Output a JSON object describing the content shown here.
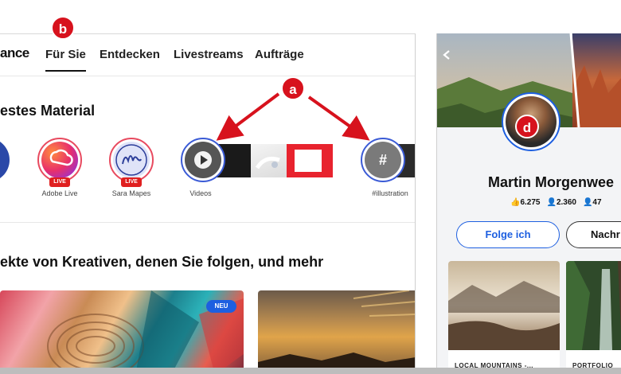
{
  "nav": {
    "brand": "ance",
    "tabs": [
      "Für Sie",
      "Entdecken",
      "Livestreams",
      "Aufträge"
    ]
  },
  "stories": {
    "title": "estes Material",
    "items": [
      {
        "label": "Adobe Live",
        "live": "LIVE"
      },
      {
        "label": "Sara Mapes",
        "live": "LIVE"
      },
      {
        "label": "Videos"
      },
      {
        "label": "#illustration",
        "glyph": "#"
      }
    ]
  },
  "feed": {
    "title": "ekte von Kreativen, denen Sie folgen, und mehr",
    "badge_new": "NEU"
  },
  "markers": {
    "a": "a",
    "b": "b",
    "d": "d"
  },
  "profile": {
    "name": "Martin Morgenwee",
    "stats": [
      "6.275",
      "2.360",
      "47"
    ],
    "follow_label": "Folge ich",
    "message_label": "Nachr",
    "projects": [
      "LOCAL MOUNTAINS -...",
      "PORTFOLIO"
    ]
  },
  "colors": {
    "accent": "#1d5fe0",
    "marker": "#d7121d",
    "live": "#e02020"
  }
}
